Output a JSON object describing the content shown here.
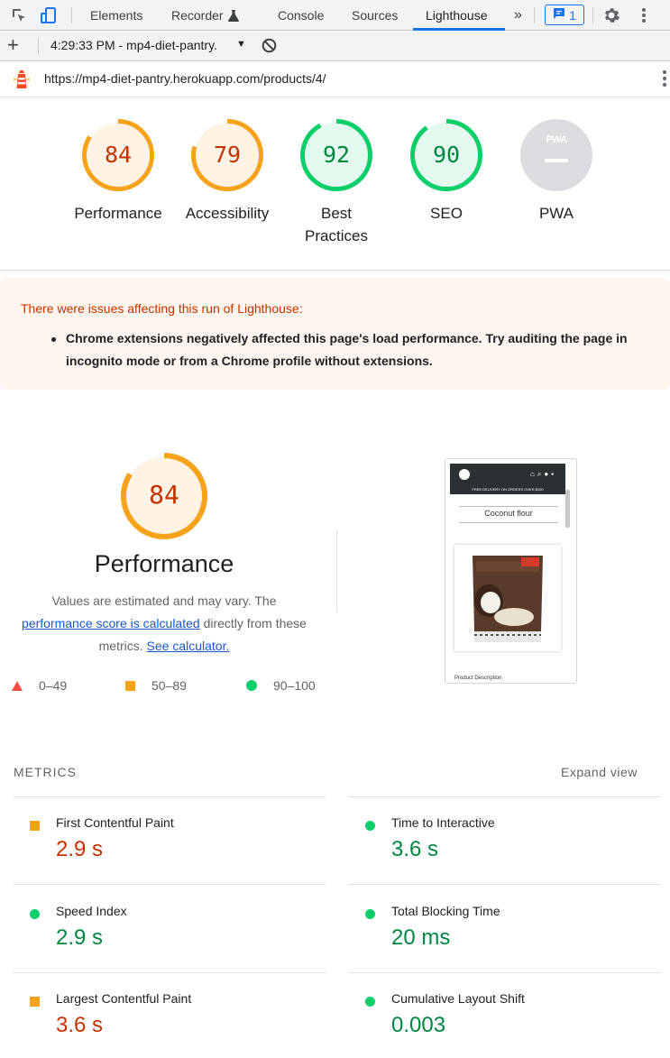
{
  "devtools": {
    "tabs": [
      "Elements",
      "Recorder",
      "Console",
      "Sources",
      "Lighthouse"
    ],
    "overflow": "»",
    "badge_count": "1",
    "active_tab": "Lighthouse"
  },
  "runbar": {
    "add": "+",
    "run_label": "4:29:33 PM - mp4-diet-pantry.",
    "caret": "▼"
  },
  "urlbar": {
    "url": "https://mp4-diet-pantry.herokuapp.com/products/4/"
  },
  "scores": [
    {
      "label": "Performance",
      "score": 84
    },
    {
      "label": "Accessibility",
      "score": 79
    },
    {
      "label": "Best Practices",
      "score": 92
    },
    {
      "label": "SEO",
      "score": 90
    },
    {
      "label": "PWA",
      "icon_text": "PWA"
    }
  ],
  "warnings": {
    "title": "There were issues affecting this run of Lighthouse:",
    "items": [
      "Chrome extensions negatively affected this page's load performance. Try auditing the page in incognito mode or from a Chrome profile without extensions."
    ]
  },
  "performance": {
    "score": "84",
    "title": "Performance",
    "desc_before": "Values are estimated and may vary. The ",
    "desc_link": "performance score is calculated",
    "desc_after": " directly from these metrics. ",
    "calc_link": "See calculator.",
    "legend": [
      "0–49",
      "50–89",
      "90–100"
    ]
  },
  "thumbnail": {
    "banner": "FREE DELIVERY ON ORDERS OVER $100",
    "product": "Coconut flour",
    "footer": "Product Description"
  },
  "metrics": {
    "title": "METRICS",
    "expand": "Expand view",
    "items": [
      {
        "name": "First Contentful Paint",
        "value": "2.9 s",
        "rating": "average"
      },
      {
        "name": "Time to Interactive",
        "value": "3.6 s",
        "rating": "pass"
      },
      {
        "name": "Speed Index",
        "value": "2.9 s",
        "rating": "pass"
      },
      {
        "name": "Total Blocking Time",
        "value": "20 ms",
        "rating": "pass"
      },
      {
        "name": "Largest Contentful Paint",
        "value": "3.6 s",
        "rating": "average"
      },
      {
        "name": "Cumulative Layout Shift",
        "value": "0.003",
        "rating": "pass"
      }
    ]
  },
  "colors": {
    "average": "#f6a31b",
    "average_text": "#c33300",
    "pass": "#0cce6b",
    "pass_text": "#018642",
    "fail": "#ff4e42",
    "accent": "#1a73e8"
  }
}
